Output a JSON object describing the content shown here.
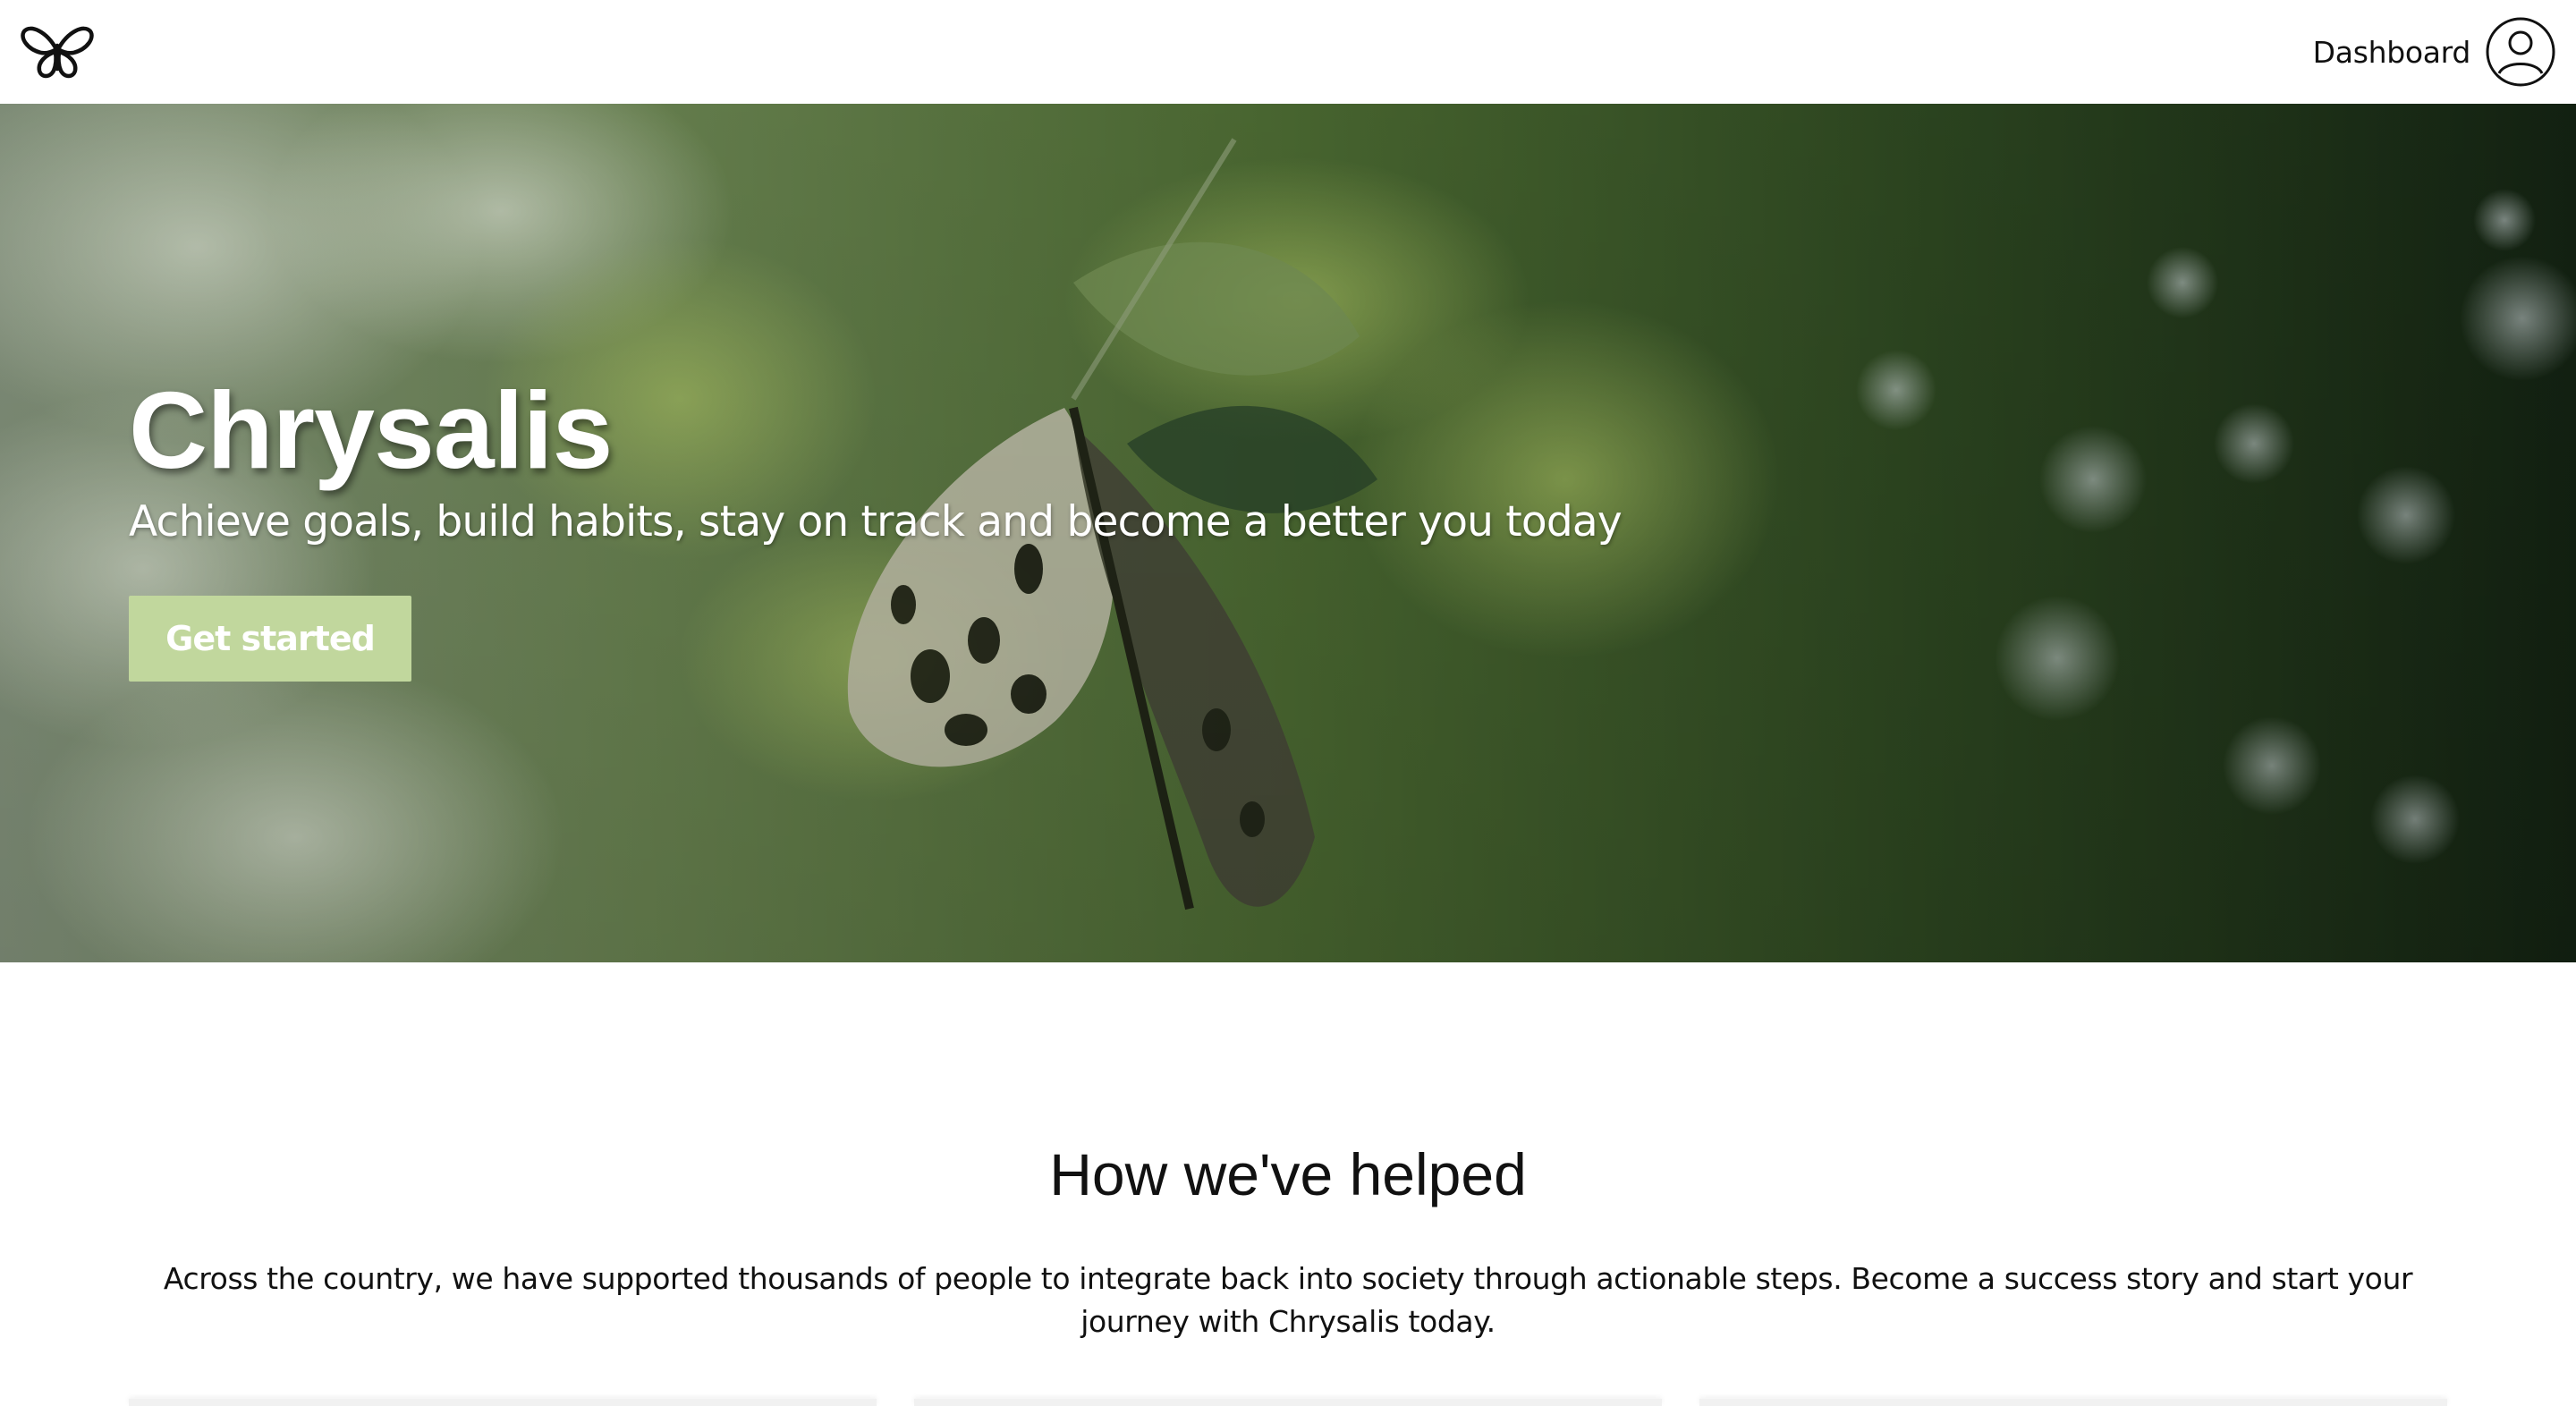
{
  "header": {
    "logo_icon": "butterfly-icon",
    "nav_link_label": "Dashboard",
    "profile_icon": "user-circle-icon"
  },
  "hero": {
    "background": "butterfly-on-leaves-photo",
    "title": "Chrysalis",
    "subtitle": "Achieve goals, build habits, stay on track and become a better you today",
    "cta_label": "Get started"
  },
  "section": {
    "title": "How we've helped",
    "body": "Across the country, we have supported thousands of people to integrate back into society through actionable steps. Become a success story and start your journey with Chrysalis today."
  },
  "colors": {
    "accent": "#c1d79d",
    "text": "#111111",
    "background": "#ffffff"
  }
}
